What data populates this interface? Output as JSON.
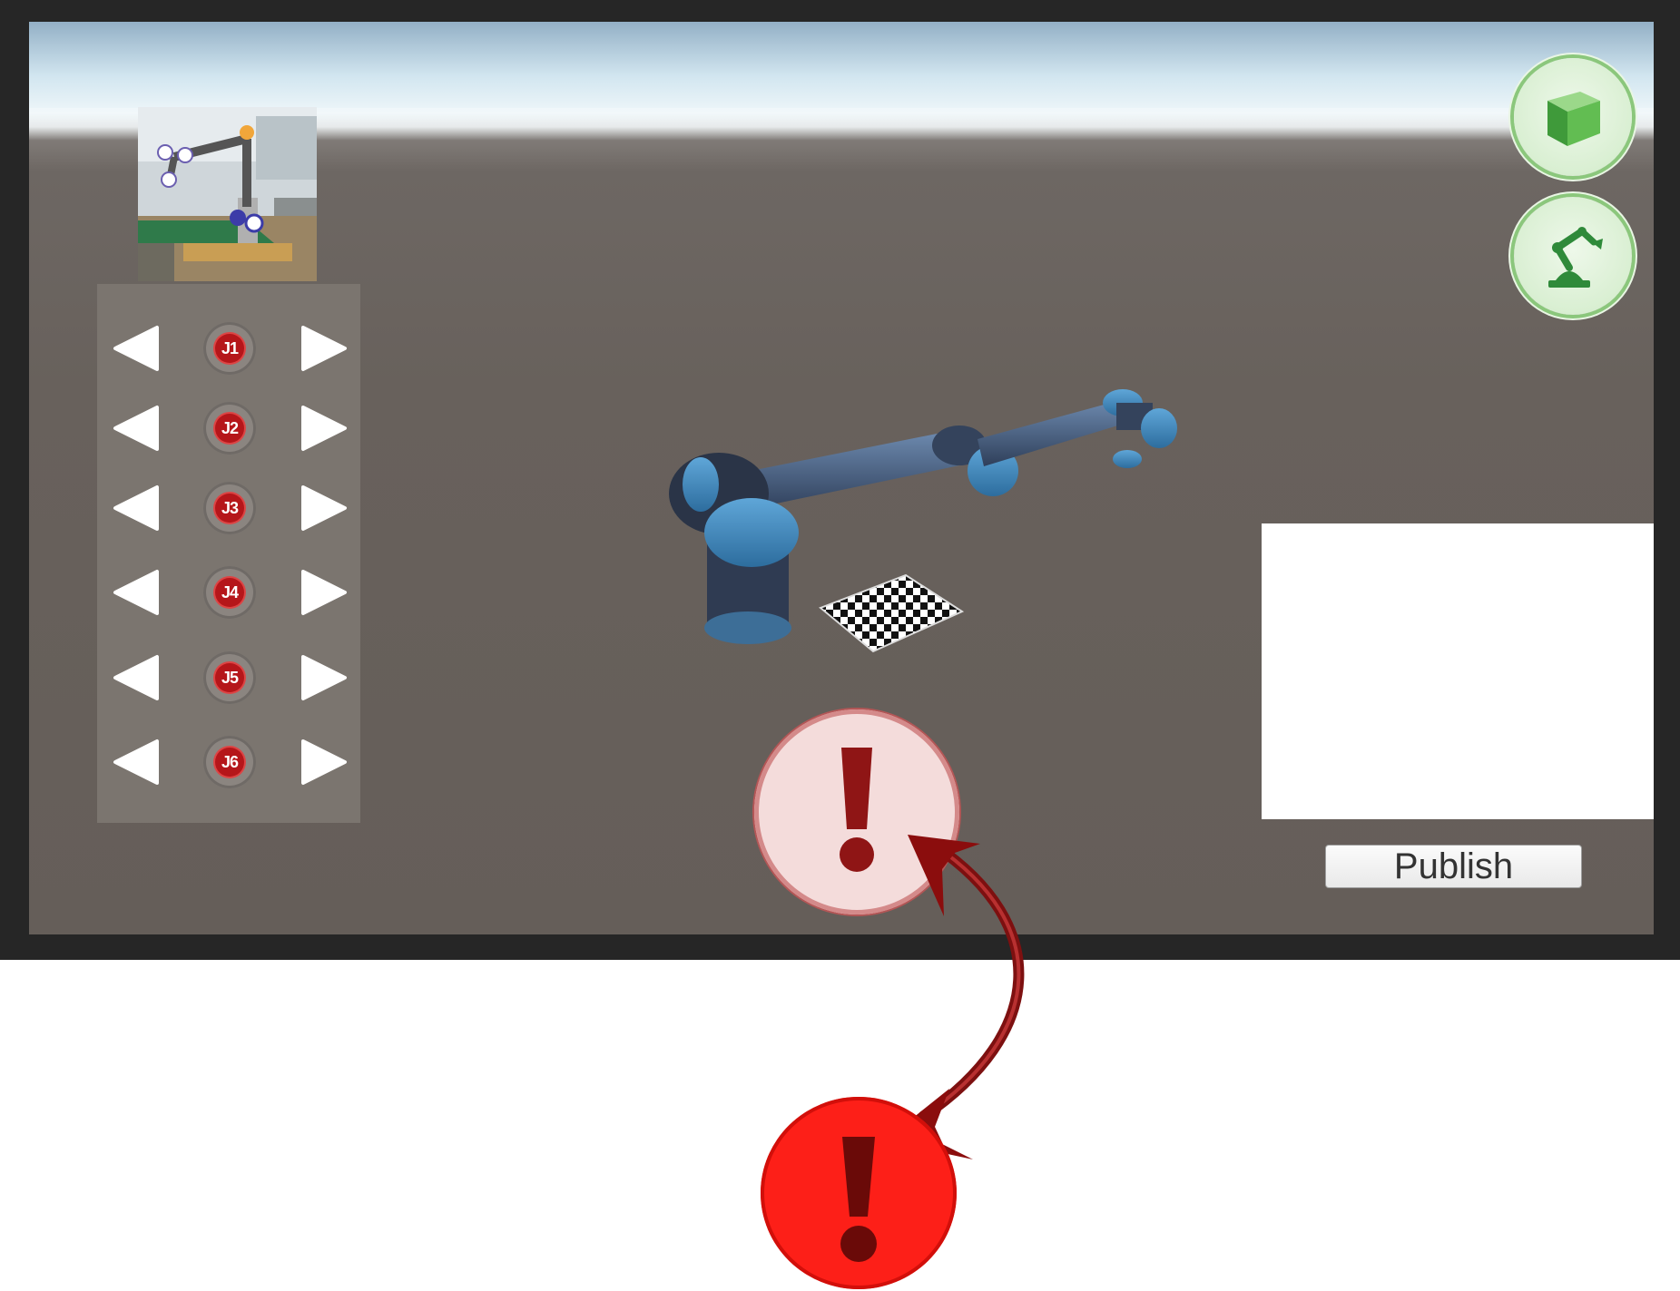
{
  "joint_panel": {
    "joints": [
      {
        "label": "J1"
      },
      {
        "label": "J2"
      },
      {
        "label": "J3"
      },
      {
        "label": "J4"
      },
      {
        "label": "J5"
      },
      {
        "label": "J6"
      }
    ]
  },
  "publish_button": {
    "label": "Publish"
  },
  "colors": {
    "alert_red": "#fd1f18",
    "joint_red": "#b5161a",
    "action_green": "#8bc77c",
    "arrow_dark_red": "#8b0d0d"
  },
  "icons": {
    "top_right_1": "cube-icon",
    "top_right_2": "robot-arm-icon",
    "center": "exclamation-icon",
    "legend": "exclamation-icon"
  }
}
